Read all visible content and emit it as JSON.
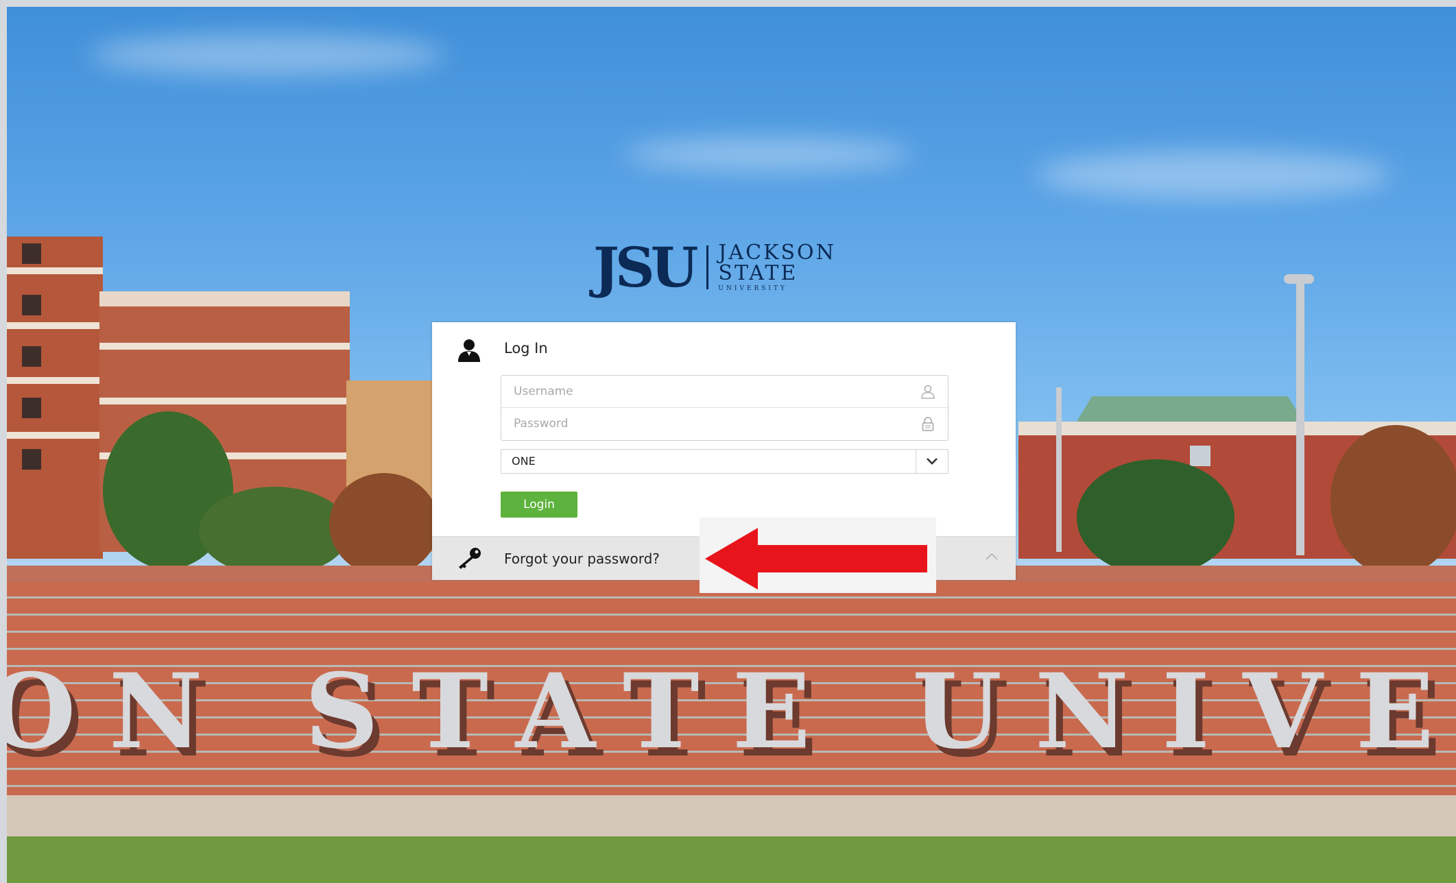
{
  "brand": {
    "logo_mark": "JSU",
    "logo_line1": "JACKSON",
    "logo_line2": "STATE",
    "logo_line3": "UNIVERSITY"
  },
  "background": {
    "wall_text": "ON STATE UNIVE"
  },
  "login": {
    "title": "Log In",
    "username_placeholder": "Username",
    "password_placeholder": "Password",
    "select_value": "ONE",
    "login_label": "Login",
    "forgot_label": "Forgot your password?"
  },
  "colors": {
    "login_button": "#5db33d",
    "annotation_arrow": "#e8141b",
    "logo_navy": "#0b2a55"
  },
  "icons": {
    "header": "user-icon",
    "username": "person-icon",
    "password": "lock-icon",
    "select": "chevron-down-icon",
    "forgot": "key-icon",
    "collapse": "chevron-up-icon",
    "annotation": "red-arrow-icon"
  }
}
